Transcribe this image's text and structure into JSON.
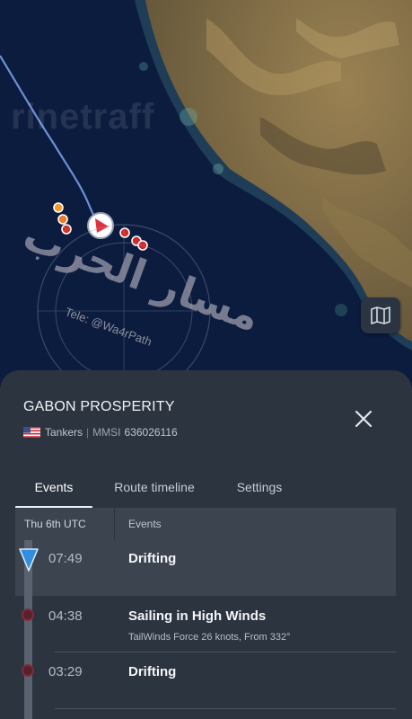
{
  "map": {
    "watermark_text": "rinetraff",
    "stamp": {
      "arabic_text": "مسار الحرب",
      "telegram_text": "Tele: @Wa4rPath"
    },
    "map_layers_icon": "folded-map-icon",
    "colors": {
      "sea": "#0c1c3f",
      "route_line": "#6e8fd4",
      "vessel_marker": "#e0313f"
    }
  },
  "vessel": {
    "name": "GABON PROSPERITY",
    "flag_icon": "us-flag-icon",
    "type": "Tankers",
    "mmsi_label": "MMSI",
    "mmsi": "636026116"
  },
  "tabs": [
    {
      "label": "Events",
      "active": true
    },
    {
      "label": "Route timeline",
      "active": false
    },
    {
      "label": "Settings",
      "active": false
    }
  ],
  "events_table": {
    "date_header": "Thu 6th UTC",
    "events_header": "Events",
    "rows": [
      {
        "time": "07:49",
        "title": "Drifting",
        "detail": "",
        "selected": true
      },
      {
        "time": "04:38",
        "title": "Sailing in High Winds",
        "detail": "TailWinds Force 26 knots, From 332°",
        "selected": false
      },
      {
        "time": "03:29",
        "title": "Drifting",
        "detail": "",
        "selected": false
      }
    ]
  }
}
